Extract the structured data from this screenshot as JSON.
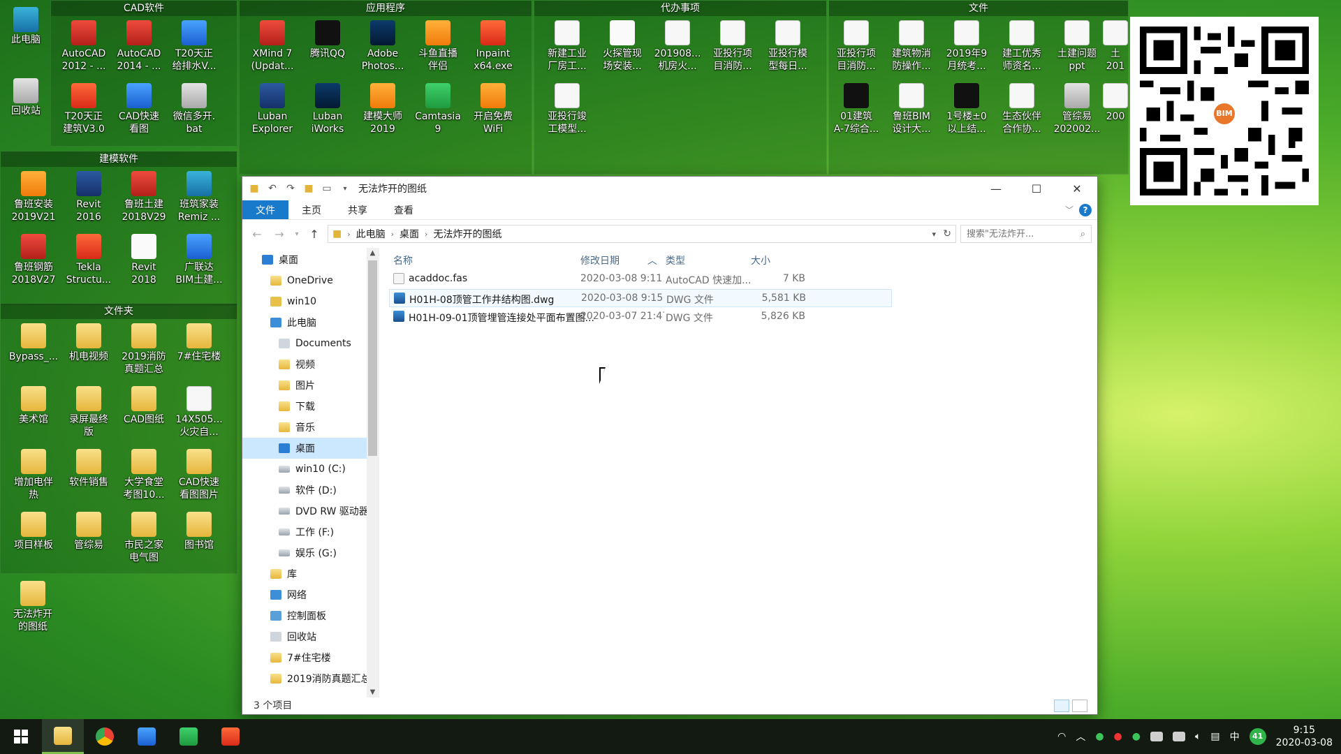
{
  "desktop": {
    "left_icons": [
      {
        "label": "此电脑",
        "icon": "this-pc-icon"
      },
      {
        "label": "回收站",
        "icon": "recycle-bin-icon"
      }
    ],
    "fences": [
      {
        "title": "CAD软件",
        "items": [
          {
            "label": "AutoCAD\n2012 - ...",
            "icon": "autocad-icon"
          },
          {
            "label": "AutoCAD\n2014 - ...",
            "icon": "autocad-icon"
          },
          {
            "label": "T20天正\n给排水V...",
            "icon": "tangent-icon"
          },
          {
            "label": "T20天正\n建筑V3.0",
            "icon": "tangent-icon"
          },
          {
            "label": "CAD快速\n看图",
            "icon": "cad-viewer-icon"
          },
          {
            "label": "微信多开.\nbat",
            "icon": "bat-file-icon"
          }
        ]
      },
      {
        "title": "应用程序",
        "items": [
          {
            "label": "XMind 7\n(Updat...",
            "icon": "xmind-icon"
          },
          {
            "label": "腾讯QQ",
            "icon": "qq-icon"
          },
          {
            "label": "Adobe\nPhotos...",
            "icon": "photoshop-icon"
          },
          {
            "label": "斗鱼直播\n伴侣",
            "icon": "douyu-icon"
          },
          {
            "label": "Inpaint\nx64.exe",
            "icon": "inpaint-icon"
          },
          {
            "label": "Luban\nExplorer",
            "icon": "luban-icon"
          },
          {
            "label": "Luban\niWorks",
            "icon": "luban-iworks-icon"
          },
          {
            "label": "建模大师\n2019",
            "icon": "modeling-master-icon"
          },
          {
            "label": "Camtasia\n9",
            "icon": "camtasia-icon"
          },
          {
            "label": "开启免费\nWiFi",
            "icon": "wifi-icon"
          }
        ]
      },
      {
        "title": "代办事项",
        "items": [
          {
            "label": "新建工业\n厂房工...",
            "icon": "word-doc-icon"
          },
          {
            "label": "火探管现\n场安装...",
            "icon": "doc-icon"
          },
          {
            "label": "201908...\n机房火...",
            "icon": "excel-doc-icon"
          },
          {
            "label": "亚投行项\n目消防...",
            "icon": "word-doc-icon"
          },
          {
            "label": "亚投行模\n型每日...",
            "icon": "excel-doc-icon"
          },
          {
            "label": "亚投行竣\n工模型...",
            "icon": "excel-doc-icon"
          }
        ]
      },
      {
        "title": "文件",
        "items": [
          {
            "label": "亚投行项\n目消防...",
            "icon": "pdf-icon"
          },
          {
            "label": "建筑物消\n防操作...",
            "icon": "excel-doc-icon"
          },
          {
            "label": "2019年9\n月统考...",
            "icon": "word-doc-icon"
          },
          {
            "label": "建工优秀\n师资名...",
            "icon": "excel-doc-icon"
          },
          {
            "label": "土建问题\nppt",
            "icon": "ppt-icon"
          },
          {
            "label": "土\n201",
            "icon": "word-doc-icon"
          },
          {
            "label": "01建筑\nA-7综合...",
            "icon": "image-icon"
          },
          {
            "label": "鲁班BIM\n设计大...",
            "icon": "word-doc-icon"
          },
          {
            "label": "1号楼±0\n以上结...",
            "icon": "image-icon"
          },
          {
            "label": "生态伙伴\n合作协...",
            "icon": "pdf-icon"
          },
          {
            "label": "管综易\n202002...",
            "icon": "gray-file-icon"
          },
          {
            "label": "200",
            "icon": "word-doc-icon"
          }
        ]
      },
      {
        "title": "建模软件",
        "items": [
          {
            "label": "鲁班安装\n2019V21",
            "icon": "luban-install-icon"
          },
          {
            "label": "Revit\n2016",
            "icon": "revit-icon"
          },
          {
            "label": "鲁班土建\n2018V29",
            "icon": "luban-civil-icon"
          },
          {
            "label": "班筑家装\nRemiz ...",
            "icon": "remiz-icon"
          },
          {
            "label": "鲁班钢筋\n2018V27",
            "icon": "luban-steel-icon"
          },
          {
            "label": "Tekla\nStructu...",
            "icon": "tekla-icon"
          },
          {
            "label": "Revit\n2018",
            "icon": "revit-icon"
          },
          {
            "label": "广联达\nBIM土建...",
            "icon": "glodon-icon"
          }
        ]
      },
      {
        "title": "文件夹",
        "items": [
          {
            "label": "Bypass_...",
            "icon": "folder-icon"
          },
          {
            "label": "机电视频",
            "icon": "folder-icon"
          },
          {
            "label": "2019消防\n真题汇总",
            "icon": "folder-icon"
          },
          {
            "label": "7#住宅楼",
            "icon": "folder-icon"
          },
          {
            "label": "美术馆",
            "icon": "folder-icon"
          },
          {
            "label": "录屏最终\n版",
            "icon": "folder-icon"
          },
          {
            "label": "CAD图纸",
            "icon": "folder-icon"
          },
          {
            "label": "14X505...\n火灾自...",
            "icon": "pdf-icon"
          },
          {
            "label": "增加电伴\n热",
            "icon": "folder-icon"
          },
          {
            "label": "软件销售",
            "icon": "folder-icon"
          },
          {
            "label": "大学食堂\n考图10...",
            "icon": "folder-icon"
          },
          {
            "label": "CAD快速\n看图图片",
            "icon": "folder-icon"
          },
          {
            "label": "项目样板",
            "icon": "folder-icon"
          },
          {
            "label": "管综易",
            "icon": "folder-icon"
          },
          {
            "label": "市民之家\n电气图",
            "icon": "folder-icon"
          },
          {
            "label": "图书馆",
            "icon": "folder-icon"
          }
        ]
      }
    ],
    "standalone": [
      {
        "label": "无法炸开\n的图纸",
        "icon": "folder-icon"
      }
    ]
  },
  "qr": {
    "badge": "BIM"
  },
  "explorer": {
    "title": "无法炸开的图纸",
    "ribbon_tabs": [
      "文件",
      "主页",
      "共享",
      "查看"
    ],
    "help": "?",
    "breadcrumb": [
      "此电脑",
      "桌面",
      "无法炸开的图纸"
    ],
    "search_placeholder": "搜索\"无法炸开...",
    "nav_items": [
      {
        "label": "桌面",
        "icon": "desktop-icon",
        "indent": 0
      },
      {
        "label": "OneDrive",
        "icon": "onedrive-icon",
        "indent": 1
      },
      {
        "label": "win10",
        "icon": "user-icon",
        "indent": 1
      },
      {
        "label": "此电脑",
        "icon": "this-pc-icon",
        "indent": 1
      },
      {
        "label": "Documents",
        "icon": "documents-icon",
        "indent": 2
      },
      {
        "label": "视频",
        "icon": "videos-icon",
        "indent": 2
      },
      {
        "label": "图片",
        "icon": "pictures-icon",
        "indent": 2
      },
      {
        "label": "下载",
        "icon": "downloads-icon",
        "indent": 2
      },
      {
        "label": "音乐",
        "icon": "music-icon",
        "indent": 2
      },
      {
        "label": "桌面",
        "icon": "desktop-icon",
        "indent": 2,
        "selected": true
      },
      {
        "label": "win10 (C:)",
        "icon": "drive-icon",
        "indent": 2
      },
      {
        "label": "软件 (D:)",
        "icon": "drive-icon",
        "indent": 2
      },
      {
        "label": "DVD RW 驱动器",
        "icon": "dvd-drive-icon",
        "indent": 2
      },
      {
        "label": "工作 (F:)",
        "icon": "drive-icon",
        "indent": 2
      },
      {
        "label": "娱乐 (G:)",
        "icon": "drive-icon",
        "indent": 2
      },
      {
        "label": "库",
        "icon": "libraries-icon",
        "indent": 1
      },
      {
        "label": "网络",
        "icon": "network-icon",
        "indent": 1
      },
      {
        "label": "控制面板",
        "icon": "control-panel-icon",
        "indent": 1
      },
      {
        "label": "回收站",
        "icon": "recycle-bin-icon",
        "indent": 1
      },
      {
        "label": "7#住宅楼",
        "icon": "folder-icon",
        "indent": 1
      },
      {
        "label": "2019消防真题汇总",
        "icon": "folder-icon",
        "indent": 1
      }
    ],
    "columns": [
      "名称",
      "修改日期",
      "类型",
      "大小"
    ],
    "files": [
      {
        "name": "acaddoc.fas",
        "date": "2020-03-08 9:11",
        "type": "AutoCAD 快速加...",
        "size": "7 KB",
        "icon": "fas-file-icon"
      },
      {
        "name": "H01H-08顶管工作井结构图.dwg",
        "date": "2020-03-08 9:15",
        "type": "DWG 文件",
        "size": "5,581 KB",
        "icon": "dwg-file-icon",
        "selected": true
      },
      {
        "name": "H01H-09-01顶管埋管连接处平面布置图...",
        "date": "2020-03-07 21:47",
        "type": "DWG 文件",
        "size": "5,826 KB",
        "icon": "dwg-file-icon"
      }
    ],
    "status": "3 个项目"
  },
  "taskbar": {
    "apps": [
      "start-icon",
      "file-explorer-icon",
      "chrome-icon",
      "wps-icon",
      "camtasia-icon",
      "camtasia-recorder-icon"
    ],
    "ime": "中",
    "notif_count": "41",
    "time": "9:15",
    "date": "2020-03-08"
  }
}
